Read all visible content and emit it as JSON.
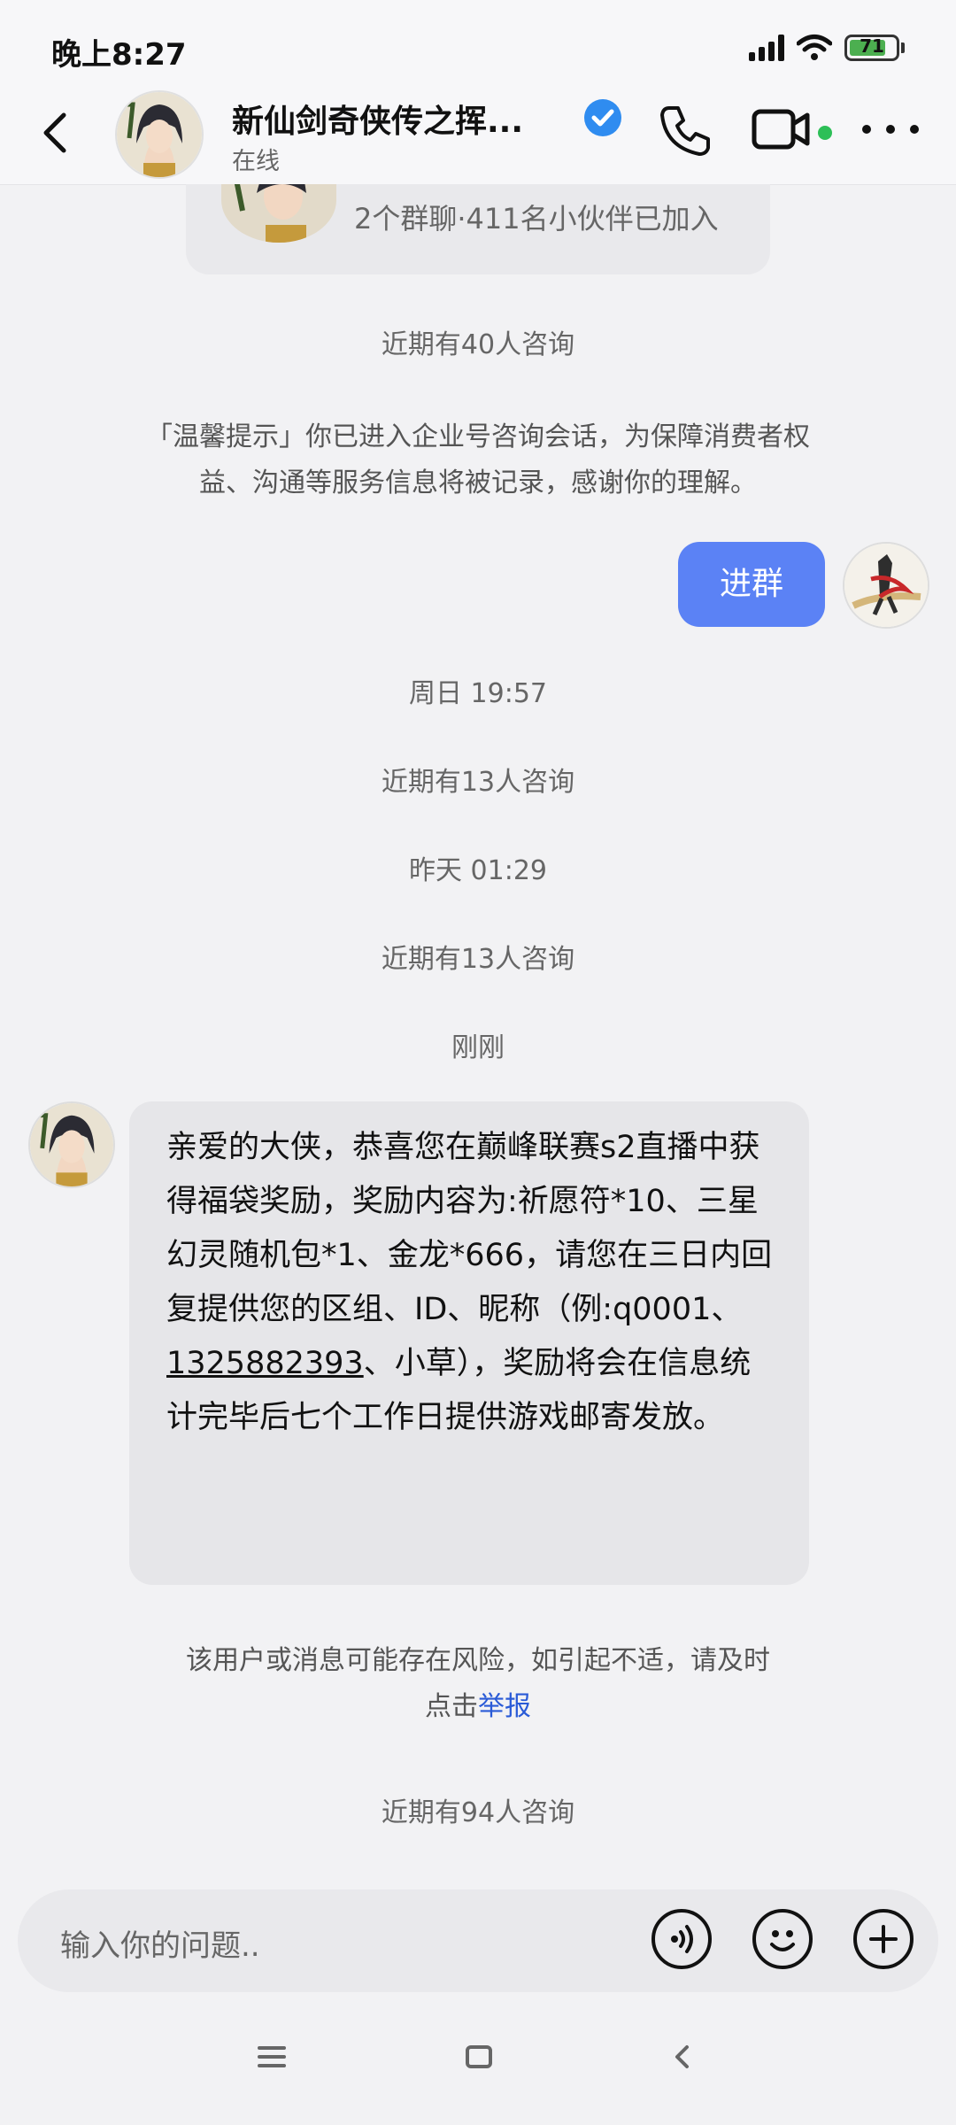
{
  "status_bar": {
    "time": "晚上8:27",
    "battery": "71"
  },
  "header": {
    "title": "新仙剑奇侠传之挥...",
    "subtitle": "在线"
  },
  "group_card": {
    "text": "2个群聊·411名小伙伴已加入"
  },
  "messages": {
    "consult_40": "近期有40人咨询",
    "notice": "「温馨提示」你已进入企业号咨询会话，为保障消费者权益、沟通等服务信息将被记录，感谢你的理解。",
    "my_message": "进群",
    "time_1": "周日 19:57",
    "consult_13_a": "近期有13人咨询",
    "time_2": "昨天 01:29",
    "consult_13_b": "近期有13人咨询",
    "time_3": "刚刚",
    "bot_message_part1": "亲爱的大侠，恭喜您在巅峰联赛s2直播中获得福袋奖励，奖励内容为:祈愿符*10、三星幻灵随机包*1、金龙*666，请您在三日内回复提供您的区组、ID、昵称（例:q0001、",
    "bot_message_phone": "1325882393",
    "bot_message_part2": "、小草），奖励将会在信息统计完毕后七个工作日提供游戏邮寄发放。",
    "risk_text": "该用户或消息可能存在风险，如引起不适，请及时点击",
    "risk_link": "举报",
    "consult_94": "近期有94人咨询"
  },
  "input": {
    "placeholder": "输入你的问题.."
  },
  "colors": {
    "accent": "#5b82f5",
    "online": "#2dbf57",
    "link": "#2a5bd7"
  },
  "icons": [
    "back-icon",
    "verified-icon",
    "phone-icon",
    "video-icon",
    "more-icon",
    "voice-icon",
    "emoji-icon",
    "plus-icon",
    "nav-menu-icon",
    "nav-home-icon",
    "nav-back-icon"
  ]
}
